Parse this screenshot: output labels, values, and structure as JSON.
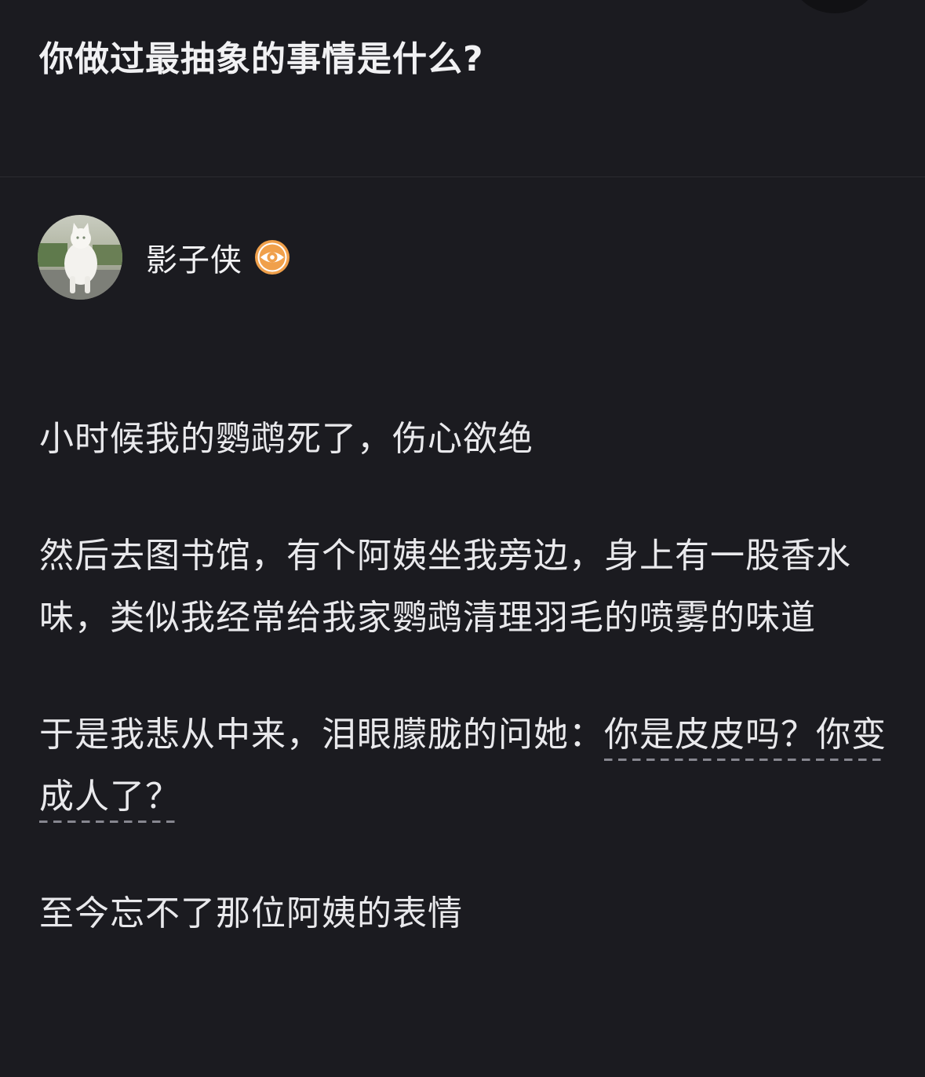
{
  "question": {
    "title": "你做过最抽象的事情是什么?"
  },
  "author": {
    "name": "影子侠",
    "avatar_icon": "white-cat-avatar",
    "badge_icon": "eye-badge-icon",
    "badge_color": "#f0a04b"
  },
  "answer": {
    "p1": "小时候我的鹦鹉死了，伤心欲绝",
    "p2": "然后去图书馆，有个阿姨坐我旁边，身上有一股香水味，类似我经常给我家鹦鹉清理羽毛的喷雾的味道",
    "p3_before": "于是我悲从中来，泪眼朦胧的问她：",
    "p3_link": "你是皮皮吗？你变成人了？",
    "p4": "至今忘不了那位阿姨的表情"
  },
  "colors": {
    "background": "#1b1b20",
    "text": "#e9e9ec",
    "link_underline": "#878790"
  }
}
